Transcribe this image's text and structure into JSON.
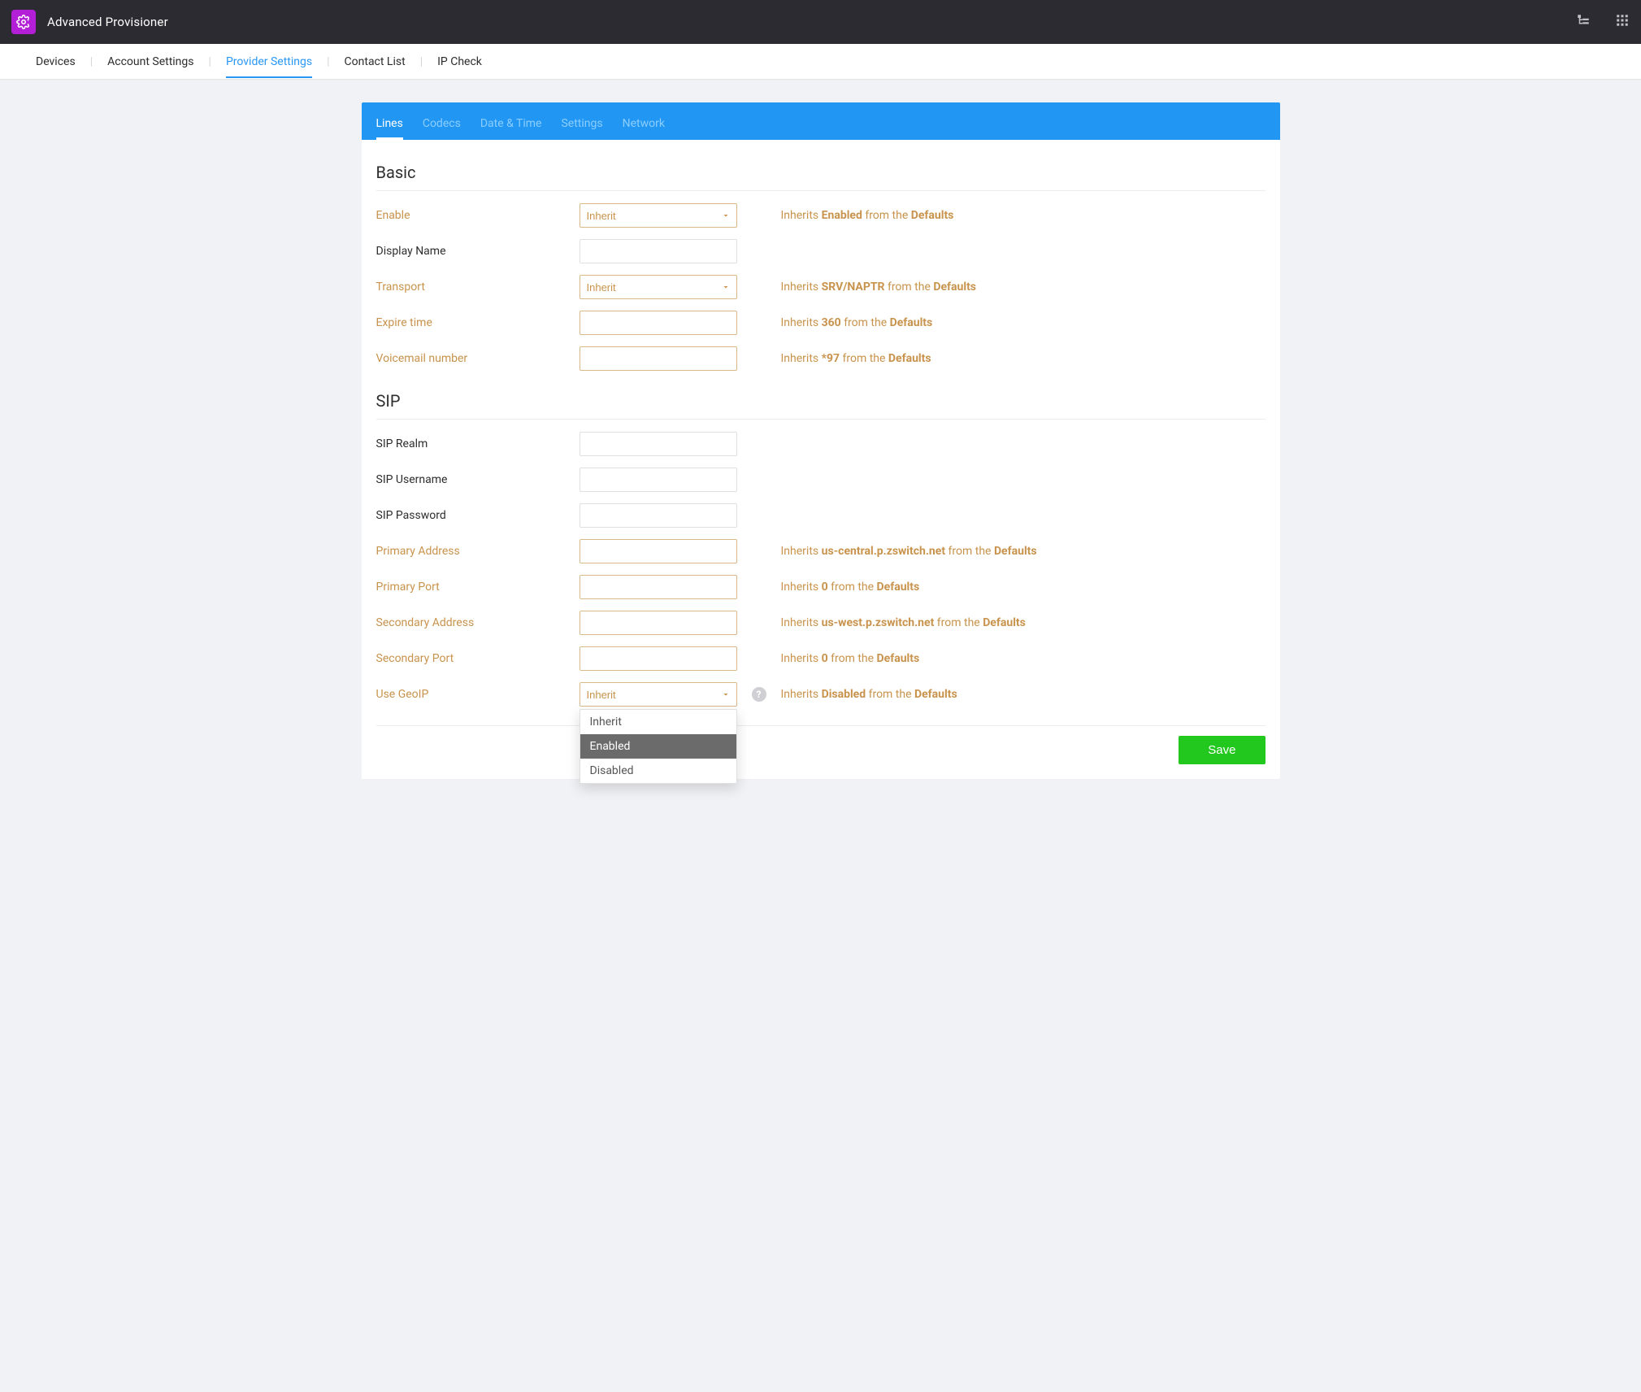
{
  "app": {
    "title": "Advanced Provisioner"
  },
  "top_nav": {
    "devices": "Devices",
    "account_settings": "Account Settings",
    "provider_settings": "Provider Settings",
    "contact_list": "Contact List",
    "ip_check": "IP Check"
  },
  "sub_tabs": {
    "lines": "Lines",
    "codecs": "Codecs",
    "datetime": "Date & Time",
    "settings": "Settings",
    "network": "Network"
  },
  "sections": {
    "basic": "Basic",
    "sip": "SIP"
  },
  "labels": {
    "enable": "Enable",
    "display_name": "Display Name",
    "transport": "Transport",
    "expire_time": "Expire time",
    "voicemail": "Voicemail number",
    "sip_realm": "SIP Realm",
    "sip_username": "SIP Username",
    "sip_password": "SIP Password",
    "primary_address": "Primary Address",
    "primary_port": "Primary Port",
    "secondary_address": "Secondary Address",
    "secondary_port": "Secondary Port",
    "use_geoip": "Use GeoIP"
  },
  "select_values": {
    "enable": "Inherit",
    "transport": "Inherit",
    "use_geoip": "Inherit"
  },
  "hints": {
    "inherits_word": "Inherits ",
    "from_defaults": " from the ",
    "defaults_word": "Defaults",
    "enable_val": "Enabled",
    "transport_val": "SRV/NAPTR",
    "expire_val": "360",
    "voicemail_val": "*97",
    "primary_addr_val": "us-central.p.zswitch.net",
    "primary_port_val": "0",
    "secondary_addr_val": "us-west.p.zswitch.net",
    "secondary_port_val": "0",
    "geoip_val": "Disabled"
  },
  "dropdown": {
    "opt_inherit": "Inherit",
    "opt_enabled": "Enabled",
    "opt_disabled": "Disabled"
  },
  "buttons": {
    "save": "Save"
  }
}
